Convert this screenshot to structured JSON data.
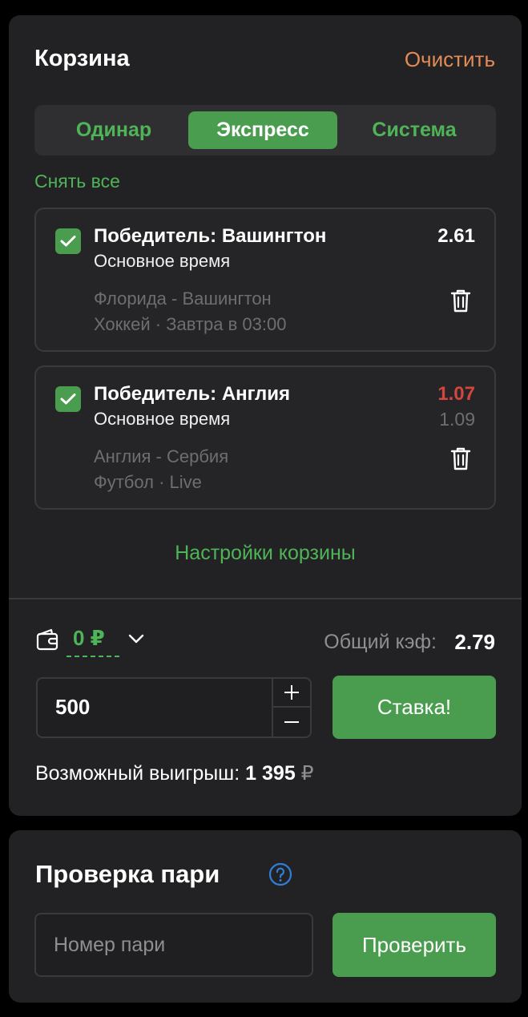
{
  "cart": {
    "title": "Корзина",
    "clear_label": "Очистить",
    "tabs": [
      {
        "label": "Одинар",
        "active": false
      },
      {
        "label": "Экспресс",
        "active": true
      },
      {
        "label": "Система",
        "active": false
      }
    ],
    "remove_all_label": "Снять все",
    "bets": [
      {
        "checked": true,
        "title": "Победитель: Вашингтон",
        "market": "Основное время",
        "match": "Флорида - Вашингтон",
        "meta": "Хоккей · Завтра в 03:00",
        "odds": "2.61",
        "odds_old": ""
      },
      {
        "checked": true,
        "title": "Победитель: Англия",
        "market": "Основное время",
        "match": "Англия - Сербия",
        "meta": "Футбол · Live",
        "odds": "1.07",
        "odds_old": "1.09"
      }
    ],
    "settings_label": "Настройки корзины",
    "balance": "0 ₽",
    "total_odds_label": "Общий кэф:",
    "total_odds_value": "2.79",
    "amount_value": "500",
    "bet_button_label": "Ставка!",
    "possible_win_label": "Возможный выигрыш:",
    "possible_win_value": "1 395",
    "possible_win_currency": "₽"
  },
  "check": {
    "title": "Проверка пари",
    "input_placeholder": "Номер пари",
    "button_label": "Проверить"
  },
  "colors": {
    "accent_green": "#4a9d4e",
    "text_green": "#4fb357",
    "clear_orange": "#e38b55",
    "odds_down_red": "#d3453d",
    "panel_bg": "#222224"
  }
}
